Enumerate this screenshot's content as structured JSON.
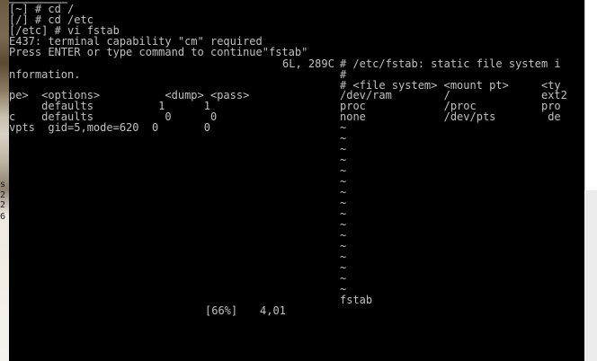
{
  "left_strip": {
    "glyphs": [
      "s",
      "2",
      "2",
      "6"
    ]
  },
  "terminal": {
    "top_lines": [
      "[~] # cd /",
      "[/] # cd /etc",
      "[/etc] # vi fstab",
      "E437: terminal capability \"cm\" required",
      "Press ENTER or type command to continue\"fstab\""
    ],
    "left_pane": {
      "file_info": "6L, 289C",
      "wrapped_line": "nformation.",
      "rows": [
        "pe>  <options>          <dump> <pass>",
        "     defaults          1      1",
        "c    defaults           0      0",
        "vpts  gid=5,mode=620  0       0"
      ]
    },
    "right_pane": {
      "rows": [
        "# /etc/fstab: static file system i",
        "#",
        "# <file system> <mount pt>     <ty",
        "/dev/ram        /              ext2",
        "proc            /proc          pro",
        "none            /dev/pts        de"
      ],
      "tilde": "~",
      "file_name": "fstab"
    },
    "status": {
      "percent": "[66%]",
      "position": "4,01"
    },
    "colors": {
      "background": "#000000",
      "text": "#c0c0c0"
    }
  }
}
